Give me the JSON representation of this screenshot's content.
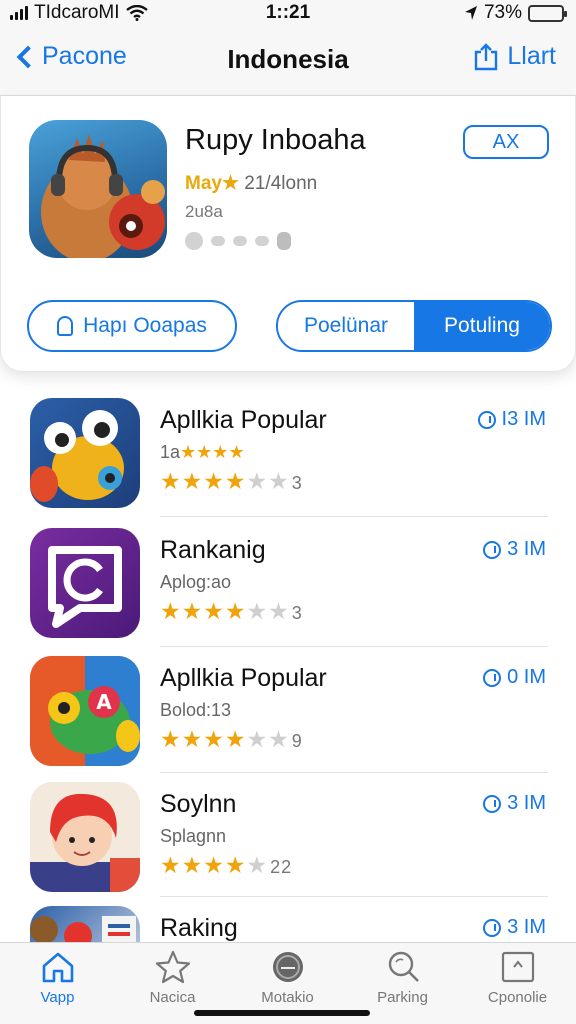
{
  "status": {
    "carrier": "TIdcaroMI",
    "time": "1::21",
    "battery": "73%",
    "battery_level": 1.0
  },
  "nav": {
    "back_label": "Pacone",
    "title": "Indonesia",
    "action_label": "Llart"
  },
  "featured": {
    "name": "Rupy Inboaha",
    "rating_prefix": "May",
    "rating_star": "★",
    "rating_text": "21/4lonn",
    "subtitle": "2u8a",
    "get_label": "AX",
    "left_button": "Hapı Ooapas",
    "segment_left": "Poelünar",
    "segment_right": "Potuling"
  },
  "apps": [
    {
      "name": "Apllkia Popular",
      "sub": "1a",
      "sub_stars": "★★★★",
      "stars": 3.5,
      "count": "3",
      "download": "I3 IM"
    },
    {
      "name": "Rankanig",
      "sub": "Aplog:ao",
      "stars": 3.5,
      "count": "3",
      "download": "3 IM"
    },
    {
      "name": "Apllkia Popular",
      "sub": "Bolod:13",
      "stars": 3.5,
      "count": "9",
      "download": "0 IM"
    },
    {
      "name": "Soylnn",
      "sub": "Splagnn",
      "stars": 4,
      "count": "22",
      "download": "3 IM"
    },
    {
      "name": "Raking",
      "sub": "",
      "stars": 0,
      "count": "",
      "download": "3 IM"
    }
  ],
  "tabs": [
    {
      "label": "Vapp",
      "icon": "home-icon",
      "active": true
    },
    {
      "label": "Nacica",
      "icon": "star-icon",
      "active": false
    },
    {
      "label": "Motakio",
      "icon": "record-icon",
      "active": false
    },
    {
      "label": "Parking",
      "icon": "search-icon",
      "active": false
    },
    {
      "label": "Cponolie",
      "icon": "image-icon",
      "active": false
    }
  ],
  "colors": {
    "accent": "#1677e5",
    "star": "#f0a30a",
    "battery": "#34c759"
  }
}
